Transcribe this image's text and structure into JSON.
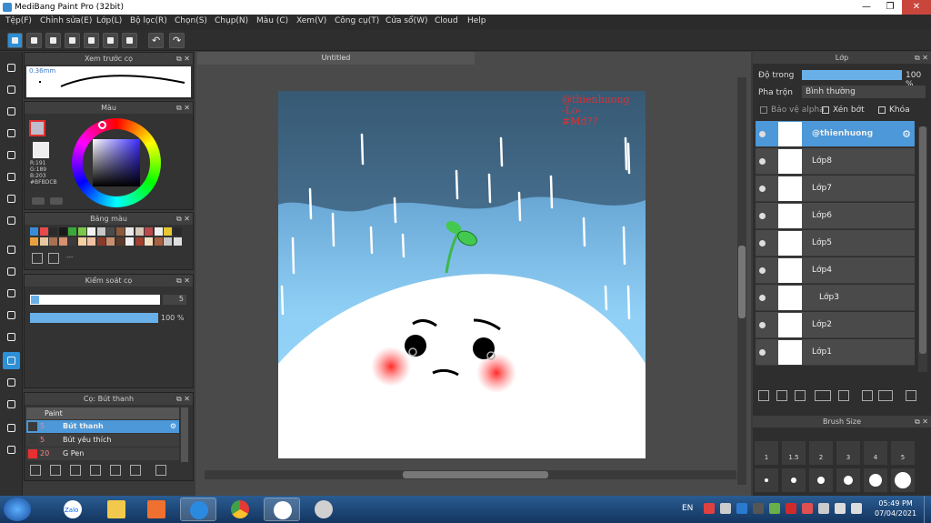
{
  "window": {
    "title": "MediBang Paint Pro (32bit)",
    "minimize": "—",
    "maximize": "❐",
    "close": "✕"
  },
  "menu": [
    "Tệp(F)",
    "Chỉnh sửa(E)",
    "Lớp(L)",
    "Bộ lọc(R)",
    "Chọn(S)",
    "Chụp(N)",
    "Màu (C)",
    "Xem(V)",
    "Công cụ(T)",
    "Cửa sổ(W)",
    "Cloud",
    "Help"
  ],
  "toolbar": {
    "icons": [
      "canvas-icon",
      "export-icon",
      "comment-icon",
      "page-icon",
      "doc-icon",
      "grid-icon",
      "snap-icon",
      "undo-icon",
      "redo-icon"
    ],
    "undo_glyph": "↶",
    "redo_glyph": "↷"
  },
  "panels": {
    "brush_preview": {
      "title": "Xem trước cọ",
      "size": "0.36mm"
    },
    "color": {
      "title": "Màu",
      "r": "R:191",
      "g": "G:189",
      "b": "B:203",
      "hex": "#BFBDCB",
      "foreground": "#e8e8e8",
      "current": "#BFBDCB"
    },
    "palette": {
      "title": "Bảng màu",
      "swatches": [
        "#3b8bd6",
        "#e84a4a",
        "#2a2a2a",
        "#1a1a1a",
        "#3aa83a",
        "#7ac74a",
        "#f2f2f2",
        "#c8c8c8",
        "#4a4a4a",
        "#8b5a3a",
        "#e8e8e8",
        "#d8c8b8",
        "#b84a4a",
        "#f0f0f0",
        "#e8c830",
        "#2a2a2a",
        "#e8a040",
        "#e8c8a0",
        "#a87050",
        "#d89070",
        "#3a3a3a",
        "#f5d0a0",
        "#f0c0a0",
        "#8a3a2a",
        "#c89070",
        "#5a3a2a",
        "#f0f0f0",
        "#a04030",
        "#f5e0c0",
        "#a86040",
        "#c8c8c8",
        "#e0e0e0"
      ],
      "dash": "---"
    },
    "brush_control": {
      "title": "Kiểm soát cọ",
      "size_value": "5",
      "opacity_value": "100 %",
      "opacity_level": 1.0
    },
    "brush_list": {
      "title": "Cọ: Bút thanh",
      "group": "Paint",
      "items": [
        {
          "size": "5",
          "name": "Bút thanh",
          "color": "#3a3a3a",
          "selected": true
        },
        {
          "size": "5",
          "name": "Bút yêu thích",
          "color": "#3a3a3a",
          "selected": false
        },
        {
          "size": "20",
          "name": "G Pen",
          "color": "#e83030",
          "selected": false
        }
      ]
    }
  },
  "canvas": {
    "tab_title": "Untitled",
    "watermark": [
      "@thienhuong",
      "-Lo-",
      "#Md??"
    ]
  },
  "layers": {
    "title": "Lớp",
    "opacity_label": "Độ trong",
    "opacity_value": "100 %",
    "blend_label": "Pha trộn",
    "blend_value": "Bình thường",
    "protect_alpha": "Bảo vệ alpha",
    "clipping": "Xén bớt",
    "lock": "Khóa",
    "items": [
      {
        "name": "@thienhuong",
        "selected": true
      },
      {
        "name": "Lớp8"
      },
      {
        "name": "Lớp7"
      },
      {
        "name": "Lớp6"
      },
      {
        "name": "Lớp5"
      },
      {
        "name": "Lớp4"
      },
      {
        "name": "Lớp3"
      },
      {
        "name": "Lớp2"
      },
      {
        "name": "Lớp1"
      }
    ]
  },
  "brush_size": {
    "title": "Brush Size",
    "labels": [
      "1",
      "1.5",
      "2",
      "3",
      "4",
      "5"
    ]
  },
  "taskbar": {
    "lang": "EN",
    "time": "05:49 PM",
    "date": "07/04/2021",
    "apps": [
      "zalo-icon",
      "folder-icon",
      "media-icon",
      "ie-icon",
      "chrome-icon",
      "paint-app-icon",
      "snipping-icon"
    ],
    "zalo_label": "Zalo"
  }
}
